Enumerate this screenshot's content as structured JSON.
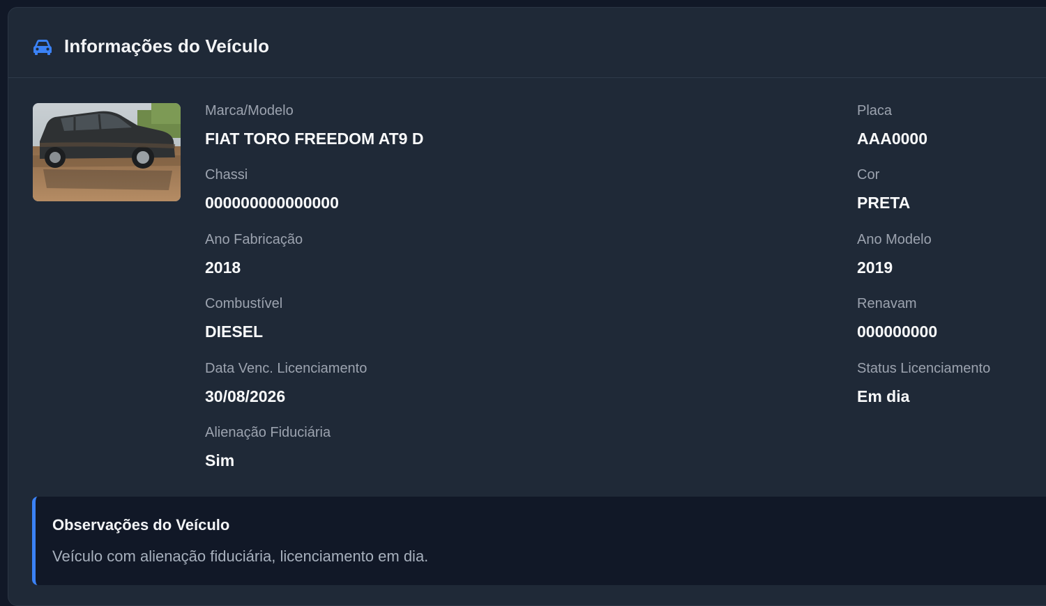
{
  "header": {
    "title": "Informações do Veículo",
    "icon": "car-icon",
    "icon_color": "#3b82f6"
  },
  "vehicle": {
    "photo_description_icon": "vehicle-photo",
    "left_fields": [
      {
        "label": "Marca/Modelo",
        "value": "FIAT TORO FREEDOM AT9 D"
      },
      {
        "label": "Chassi",
        "value": "000000000000000"
      },
      {
        "label": "Ano Fabricação",
        "value": "2018"
      },
      {
        "label": "Combustível",
        "value": "DIESEL"
      },
      {
        "label": "Data Venc. Licenciamento",
        "value": "30/08/2026"
      },
      {
        "label": "Alienação Fiduciária",
        "value": "Sim"
      }
    ],
    "right_fields": [
      {
        "label": "Placa",
        "value": "AAA0000"
      },
      {
        "label": "Cor",
        "value": "PRETA"
      },
      {
        "label": "Ano Modelo",
        "value": "2019"
      },
      {
        "label": "Renavam",
        "value": "000000000"
      },
      {
        "label": "Status Licenciamento",
        "value": "Em dia"
      }
    ]
  },
  "observations": {
    "title": "Observações do Veículo",
    "text": "Veículo com alienação fiduciária, licenciamento em dia.",
    "accent_color": "#3b82f6"
  }
}
